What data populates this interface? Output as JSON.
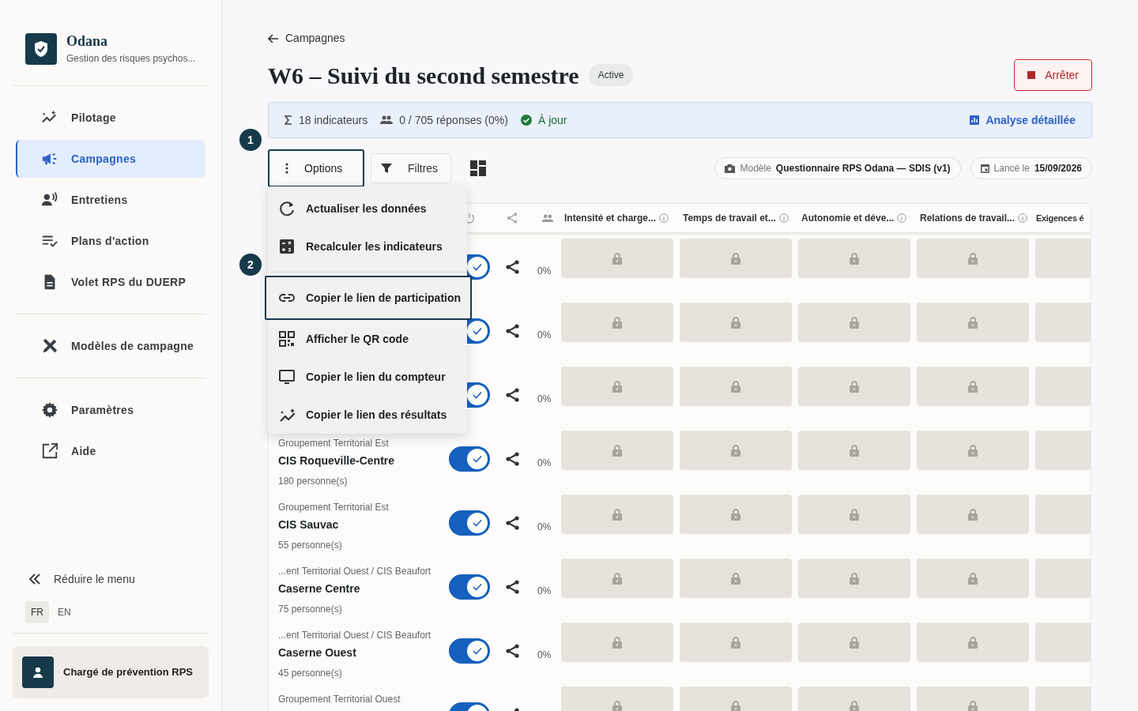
{
  "brand": {
    "name": "Odana",
    "subtitle": "Gestion des risques psychos..."
  },
  "sidebar": {
    "sections": [
      {
        "items": [
          {
            "label": "Pilotage",
            "selected": false
          },
          {
            "label": "Campagnes",
            "selected": true
          },
          {
            "label": "Entretiens",
            "selected": false
          },
          {
            "label": "Plans d'action",
            "selected": false
          },
          {
            "label": "Volet RPS du DUERP",
            "selected": false
          }
        ]
      },
      {
        "items": [
          {
            "label": "Modèles de campagne",
            "selected": false
          }
        ]
      },
      {
        "items": [
          {
            "label": "Paramètres",
            "selected": false
          },
          {
            "label": "Aide",
            "selected": false
          }
        ]
      }
    ],
    "collapse": "Réduire le menu",
    "languages": [
      {
        "label": "FR",
        "selected": true
      },
      {
        "label": "EN",
        "selected": false
      }
    ],
    "user": "Chargé de prévention RPS"
  },
  "back_link": "Campagnes",
  "title": "W6 – Suivi du second semestre",
  "status_badge": "Active",
  "stop_button": "Arrêter",
  "info_bar": {
    "indicators": "18 indicateurs",
    "responses": "0 / 705 réponses (0%)",
    "sync": "À jour",
    "link": "Analyse détaillée"
  },
  "toolbar": {
    "options": {
      "label": "Options",
      "expanded": true
    },
    "filters": "Filtres",
    "model_label": "Modèle",
    "model": "Questionnaire RPS Odana — SDIS (v1)",
    "launch_label": "Lancé le",
    "launch_date": "15/09/2026"
  },
  "steps": [
    "1",
    "2"
  ],
  "menu": [
    {
      "label": "Actualiser les données",
      "selected": false
    },
    {
      "label": "Recalculer les indicateurs",
      "selected": false
    },
    {
      "label": "Copier le lien de participation",
      "selected": true
    },
    {
      "label": "Afficher le QR code",
      "selected": false
    },
    {
      "label": "Copier le lien du compteur",
      "selected": false
    },
    {
      "label": "Copier le lien des résultats",
      "selected": false
    }
  ],
  "table": {
    "columns": [
      "Intensité et charge...",
      "Temps de travail et...",
      "Autonomie et déve...",
      "Relations de travail...",
      "Exigences é"
    ],
    "rows": [
      {
        "on": true,
        "percent": "0%",
        "locked": true
      },
      {
        "on": true,
        "percent": "0%",
        "locked": true
      },
      {
        "on": true,
        "percent": "0%",
        "locked": true
      },
      {
        "group": "Groupement Territorial Est",
        "name": "CIS Roqueville-Centre",
        "count": "180 personne(s)",
        "on": true,
        "percent": "0%",
        "locked": true
      },
      {
        "group": "Groupement Territorial Est",
        "name": "CIS Sauvac",
        "count": "55 personne(s)",
        "on": true,
        "percent": "0%",
        "locked": true
      },
      {
        "group": "...ent Territorial Ouest / CIS Beaufort",
        "name": "Caserne Centre",
        "count": "75 personne(s)",
        "on": true,
        "percent": "0%",
        "locked": true
      },
      {
        "group": "...ent Territorial Ouest / CIS Beaufort",
        "name": "Caserne Ouest",
        "count": "45 personne(s)",
        "on": true,
        "percent": "0%",
        "locked": true
      },
      {
        "group": "Groupement Territorial Ouest",
        "on": true,
        "locked": true
      }
    ]
  }
}
